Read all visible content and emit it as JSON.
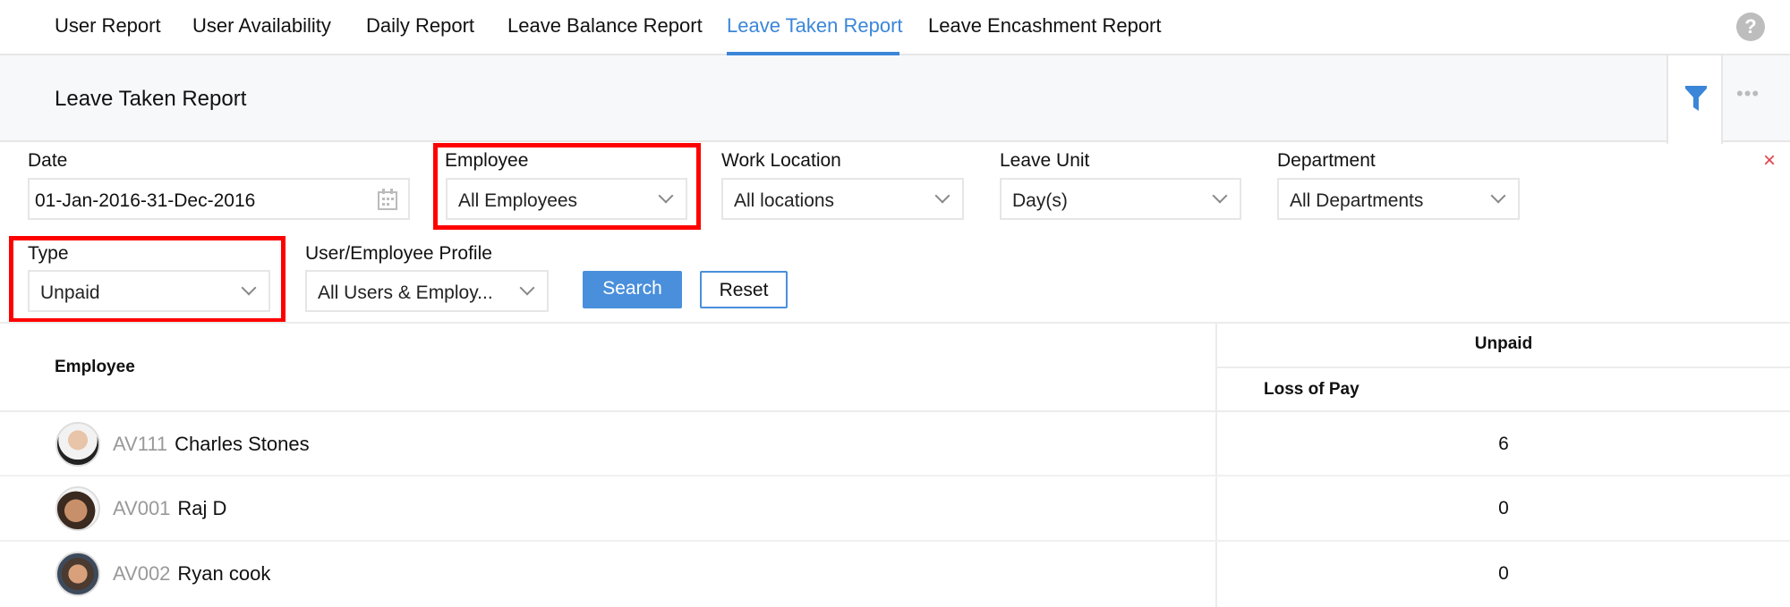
{
  "tabs": [
    {
      "label": "User Report"
    },
    {
      "label": "User Availability"
    },
    {
      "label": "Daily Report"
    },
    {
      "label": "Leave Balance Report"
    },
    {
      "label": "Leave Taken Report",
      "active": true
    },
    {
      "label": "Leave Encashment Report"
    }
  ],
  "header": {
    "title": "Leave Taken Report"
  },
  "filters": {
    "date": {
      "label": "Date",
      "value": "01-Jan-2016-31-Dec-2016"
    },
    "employee": {
      "label": "Employee",
      "value": "All Employees"
    },
    "work_location": {
      "label": "Work Location",
      "value": "All locations"
    },
    "leave_unit": {
      "label": "Leave Unit",
      "value": "Day(s)"
    },
    "department": {
      "label": "Department",
      "value": "All Departments"
    },
    "type": {
      "label": "Type",
      "value": "Unpaid"
    },
    "profile": {
      "label": "User/Employee Profile",
      "value": "All Users & Employ..."
    },
    "search_label": "Search",
    "reset_label": "Reset",
    "close_label": "×"
  },
  "table": {
    "employee_header": "Employee",
    "group_header": "Unpaid",
    "sub_header": "Loss of Pay",
    "rows": [
      {
        "id": "AV111",
        "name": "Charles Stones",
        "value": "6"
      },
      {
        "id": "AV001",
        "name": "Raj D",
        "value": "0"
      },
      {
        "id": "AV002",
        "name": "Ryan cook",
        "value": "0"
      }
    ]
  },
  "colors": {
    "accent": "#3b86d8",
    "highlight": "#ff0000"
  }
}
